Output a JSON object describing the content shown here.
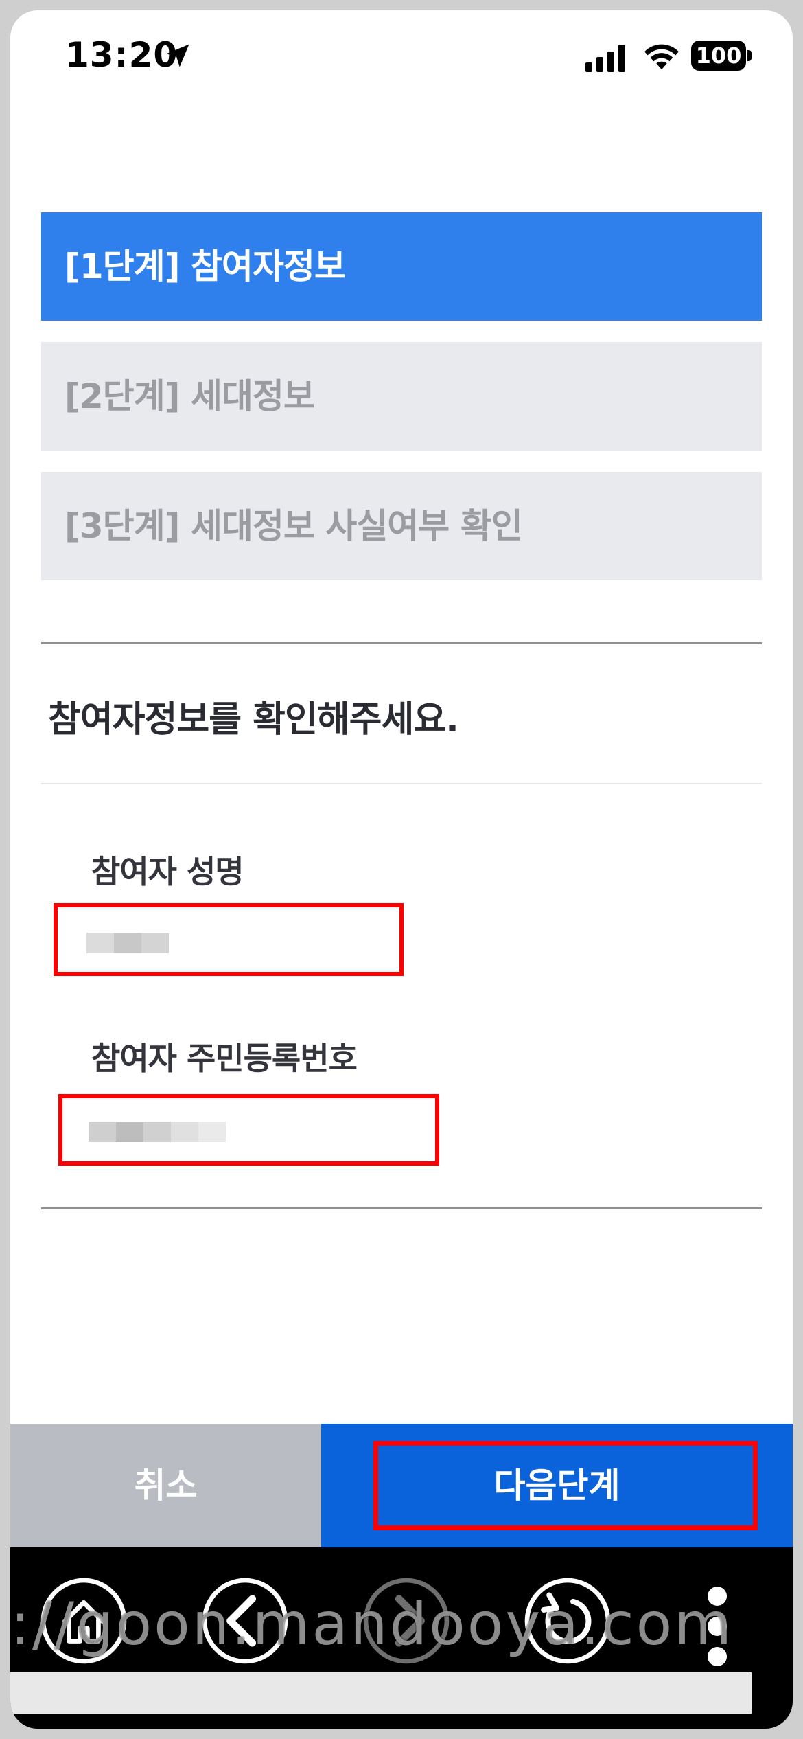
{
  "status_bar": {
    "time": "13:20",
    "battery": "100",
    "icons": [
      "location-arrow-icon",
      "cellular-signal-icon",
      "wifi-icon",
      "battery-icon"
    ]
  },
  "steps": [
    {
      "label": "[1단계] 참여자정보",
      "state": "active"
    },
    {
      "label": "[2단계] 세대정보",
      "state": "inactive"
    },
    {
      "label": "[3단계] 세대정보 사실여부 확인",
      "state": "inactive"
    }
  ],
  "form": {
    "prompt": "참여자정보를 확인해주세요.",
    "name_label": "참여자 성명",
    "rrn_label": "참여자 주민등록번호"
  },
  "actions": {
    "cancel_label": "취소",
    "next_label": "다음단계"
  },
  "browser_toolbar": {
    "buttons": [
      "home-icon",
      "back-icon",
      "forward-icon",
      "refresh-icon",
      "more-icon"
    ]
  },
  "watermark": "://goon.mandooya.com",
  "colors": {
    "active_step": "#2f80ed",
    "inactive_step": "#e9eaed",
    "next_button": "#0a63db",
    "cancel_button": "#b9bcc2",
    "highlight": "#ff0000"
  }
}
